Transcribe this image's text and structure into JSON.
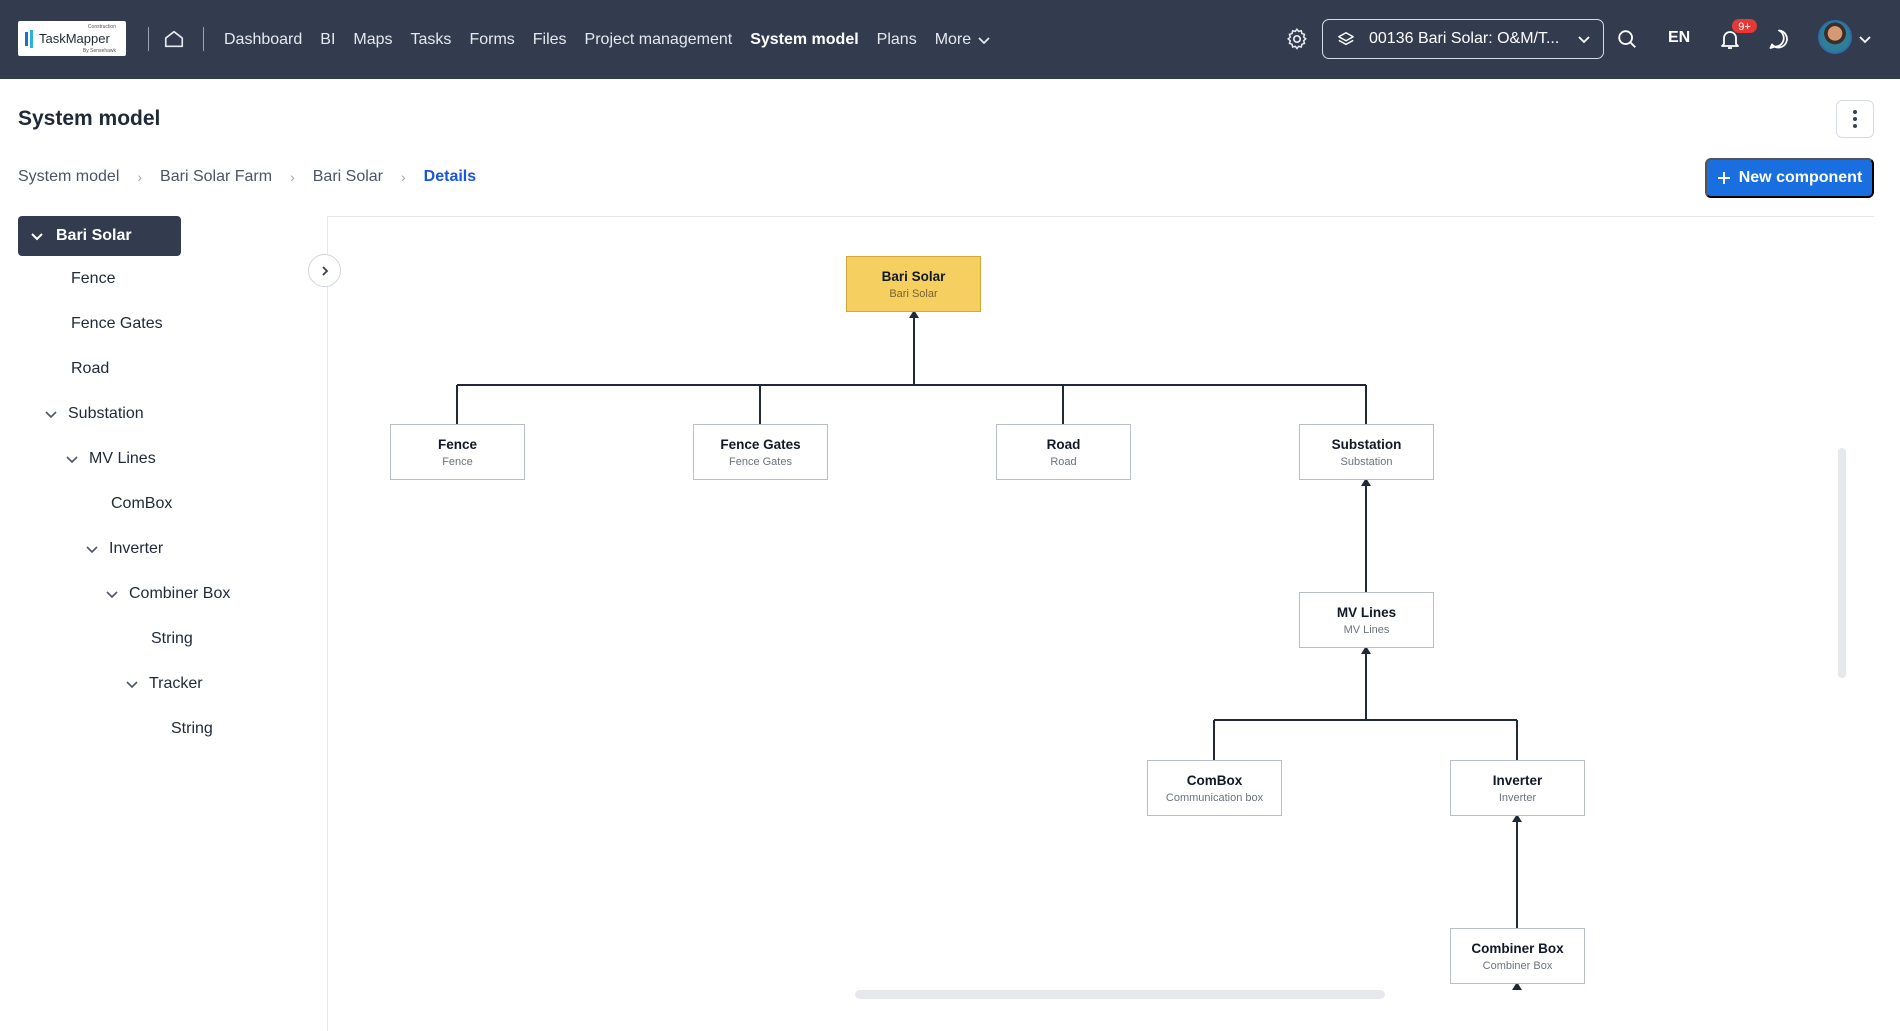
{
  "app": {
    "logo_text": "TaskMapper",
    "logo_super": "Construction",
    "logo_sub": "By Sensehawk"
  },
  "nav": {
    "items": [
      "Dashboard",
      "BI",
      "Maps",
      "Tasks",
      "Forms",
      "Files",
      "Project management",
      "System model",
      "Plans"
    ],
    "active": "System model",
    "more_label": "More"
  },
  "header": {
    "project": "00136 Bari Solar: O&M/T...",
    "language": "EN",
    "notifications": "9+"
  },
  "page": {
    "title": "System model",
    "new_button": "New component"
  },
  "breadcrumb": [
    "System model",
    "Bari Solar Farm",
    "Bari Solar",
    "Details"
  ],
  "tree": {
    "root": "Bari Solar",
    "items": [
      {
        "label": "Fence",
        "expandable": false
      },
      {
        "label": "Fence Gates",
        "expandable": false
      },
      {
        "label": "Road",
        "expandable": false
      },
      {
        "label": "Substation",
        "expandable": true
      },
      {
        "label": "MV Lines",
        "expandable": true
      },
      {
        "label": "ComBox",
        "expandable": false
      },
      {
        "label": "Inverter",
        "expandable": true
      },
      {
        "label": "Combiner Box",
        "expandable": true
      },
      {
        "label": "String",
        "expandable": false
      },
      {
        "label": "Tracker",
        "expandable": true
      },
      {
        "label": "String",
        "expandable": false
      }
    ]
  },
  "diagram": {
    "nodes": [
      {
        "title": "Bari Solar",
        "subtitle": "Bari Solar"
      },
      {
        "title": "Fence",
        "subtitle": "Fence"
      },
      {
        "title": "Fence Gates",
        "subtitle": "Fence Gates"
      },
      {
        "title": "Road",
        "subtitle": "Road"
      },
      {
        "title": "Substation",
        "subtitle": "Substation"
      },
      {
        "title": "MV Lines",
        "subtitle": "MV Lines"
      },
      {
        "title": "ComBox",
        "subtitle": "Communication box"
      },
      {
        "title": "Inverter",
        "subtitle": "Inverter"
      },
      {
        "title": "Combiner Box",
        "subtitle": "Combiner Box"
      }
    ],
    "root_color": "#f5cf60"
  },
  "icons": {
    "home": "home-icon",
    "settings": "gear-icon",
    "search": "search-icon",
    "notifications": "bell-icon",
    "messages": "chat-icon",
    "menu": "kebab-icon"
  },
  "colors": {
    "topbar": "#323c4e",
    "accent": "#1a6fe0"
  }
}
